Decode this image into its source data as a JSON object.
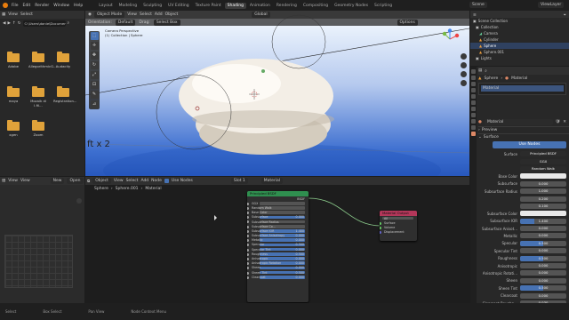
{
  "menubar": {
    "menus": [
      "File",
      "Edit",
      "Render",
      "Window",
      "Help"
    ],
    "workspaces": [
      "Layout",
      "Modeling",
      "Sculpting",
      "UV Editing",
      "Texture Paint",
      "Shading",
      "Animation",
      "Rendering",
      "Compositing",
      "Geometry Nodes",
      "Scripting"
    ],
    "active_workspace": "Shading",
    "scene": "Scene",
    "view_layer": "ViewLayer"
  },
  "file_browser": {
    "menus": [
      "View",
      "Select"
    ],
    "path": "C:\\Users\\danie\\Documents\\",
    "folders": [
      "Adobe",
      "AllegorithmicG...",
      "Audacity",
      "maya",
      "Mozaik di I.fil...",
      "Registration...",
      "xgen",
      "Zoom"
    ]
  },
  "viewport": {
    "mode": "Object Mode",
    "menus": [
      "View",
      "Select",
      "Add",
      "Object"
    ],
    "orientation_label": "Orientation:",
    "orientation": "Default",
    "drag_label": "Drag:",
    "drag": "Select Box",
    "transform": "Global",
    "options_label": "Options",
    "camera_line1": "Camera Perspective",
    "camera_line2": "(1) Collection | Sphere",
    "overlay_text": "ft x 2"
  },
  "outliner": {
    "title": "Scene Collection",
    "items": [
      "Collection",
      "Camera",
      "Cylinder",
      "Sphere",
      "Sphere.001",
      "Lights"
    ]
  },
  "properties": {
    "object": "Sphere",
    "material_tab": "Material",
    "slot": "Material",
    "material_name": "Material",
    "preview": "Preview",
    "surface_section": "Surface",
    "use_nodes": "Use Nodes",
    "surface_label": "Surface",
    "surface_value": "Principled BSDF",
    "ggx": "GGX",
    "random_walk": "Random Walk",
    "rows": [
      {
        "label": "Base Color",
        "value": "",
        "kind": "white"
      },
      {
        "label": "Subsurface",
        "value": "0.000",
        "kind": "num"
      },
      {
        "label": "Subsurface Radius",
        "value": "1.000",
        "kind": "num"
      },
      {
        "label": "",
        "value": "0.200",
        "kind": "num"
      },
      {
        "label": "",
        "value": "0.100",
        "kind": "num"
      },
      {
        "label": "Subsurface Color",
        "value": "",
        "kind": "white"
      },
      {
        "label": "Subsurface IOR",
        "value": "1.400",
        "kind": "num",
        "fill": 0.3
      },
      {
        "label": "Subsurface Anisot...",
        "value": "0.000",
        "kind": "num"
      },
      {
        "label": "Metallic",
        "value": "0.000",
        "kind": "num"
      },
      {
        "label": "Specular",
        "value": "0.500",
        "kind": "num",
        "fill": 0.5
      },
      {
        "label": "Specular Tint",
        "value": "0.000",
        "kind": "num"
      },
      {
        "label": "Roughness",
        "value": "0.500",
        "kind": "num",
        "fill": 0.5
      },
      {
        "label": "Anisotropic",
        "value": "0.000",
        "kind": "num"
      },
      {
        "label": "Anisotropic Rotati...",
        "value": "0.000",
        "kind": "num"
      },
      {
        "label": "Sheen",
        "value": "0.000",
        "kind": "num"
      },
      {
        "label": "Sheen Tint",
        "value": "0.500",
        "kind": "num",
        "fill": 0.5
      },
      {
        "label": "Clearcoat",
        "value": "0.000",
        "kind": "num"
      },
      {
        "label": "Clearcoat Roughn...",
        "value": "0.030",
        "kind": "num"
      }
    ]
  },
  "image_editor": {
    "menus": [
      "View",
      "View"
    ],
    "new_label": "New",
    "open_label": "Open"
  },
  "node_editor": {
    "type": "Object",
    "menus": [
      "View",
      "Select",
      "Add",
      "Node"
    ],
    "use_nodes": "Use Nodes",
    "slot": "Slot 1",
    "material": "Material",
    "breadcrumb": [
      "Sphere",
      "Sphere.001",
      "Material"
    ],
    "bsdf": {
      "title": "Principled BSDF",
      "out": "BSDF",
      "rows": [
        {
          "label": "GGX",
          "kind": "grey"
        },
        {
          "label": "Random Walk",
          "kind": "grey"
        },
        {
          "label": "Base Color",
          "kind": "grey"
        },
        {
          "label": "Subsurface",
          "value": "0.000"
        },
        {
          "label": "Subsurface Radius",
          "kind": "grey"
        },
        {
          "label": "Subsurface Co...",
          "kind": "grey"
        },
        {
          "label": "Subsurface IOR",
          "value": "1.400"
        },
        {
          "label": "Subsurface Anisotropy",
          "value": "0.000"
        },
        {
          "label": "Metallic",
          "value": "0.000"
        },
        {
          "label": "Specular",
          "value": "0.500"
        },
        {
          "label": "Specular Tint",
          "value": "0.000"
        },
        {
          "label": "Roughness",
          "value": "0.500"
        },
        {
          "label": "Anisotropic",
          "value": "0.000"
        },
        {
          "label": "Anisotropic Rotation",
          "value": "0.000"
        },
        {
          "label": "Sheen",
          "value": "0.000"
        },
        {
          "label": "Sheen Tint",
          "value": "0.500"
        },
        {
          "label": "Clearcoat",
          "value": "0.000"
        }
      ]
    },
    "output": {
      "title": "Material Output",
      "target": "All",
      "rows": [
        "Surface",
        "Volume",
        "Displacement"
      ]
    }
  },
  "statusbar": {
    "items": [
      "Select",
      "Box Select",
      "Pan View",
      "Node Context Menu"
    ]
  },
  "colors": {
    "accent": "#4772b3",
    "bsdf_header": "#2f8f4f",
    "output_header": "#b3375a",
    "folder": "#e0a23a"
  }
}
